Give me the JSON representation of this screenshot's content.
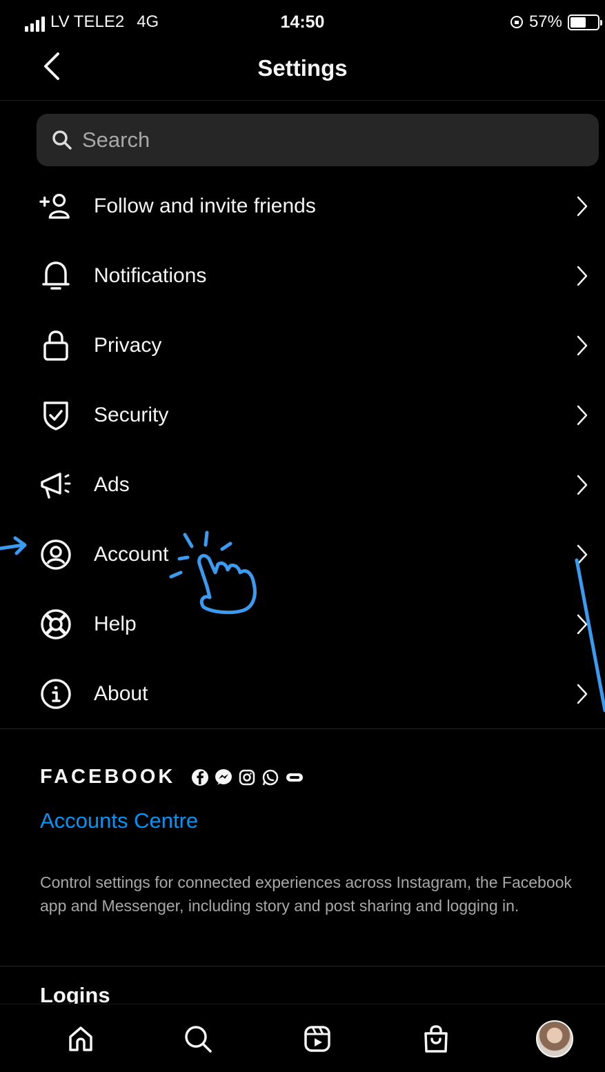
{
  "status_bar": {
    "carrier": "LV TELE2",
    "network": "4G",
    "time": "14:50",
    "battery": "57%",
    "battery_level": 0.57
  },
  "header": {
    "title": "Settings"
  },
  "search": {
    "placeholder": "Search"
  },
  "menu": [
    {
      "label": "Follow and invite friends",
      "icon": "add-person-icon"
    },
    {
      "label": "Notifications",
      "icon": "bell-icon"
    },
    {
      "label": "Privacy",
      "icon": "lock-icon"
    },
    {
      "label": "Security",
      "icon": "shield-icon"
    },
    {
      "label": "Ads",
      "icon": "megaphone-icon"
    },
    {
      "label": "Account",
      "icon": "account-icon"
    },
    {
      "label": "Help",
      "icon": "lifebuoy-icon"
    },
    {
      "label": "About",
      "icon": "info-icon"
    }
  ],
  "facebook": {
    "brand": "FACEBOOK",
    "link": "Accounts Centre",
    "description": "Control settings for connected experiences across Instagram, the Facebook app and Messenger, including story and post sharing and logging in.",
    "link_color": "#0095f6"
  },
  "next_section": "Logins",
  "tabbar": [
    "home-icon",
    "search-icon",
    "reels-icon",
    "shop-icon",
    "profile-avatar"
  ],
  "annotation_color": "#3a9bf0"
}
